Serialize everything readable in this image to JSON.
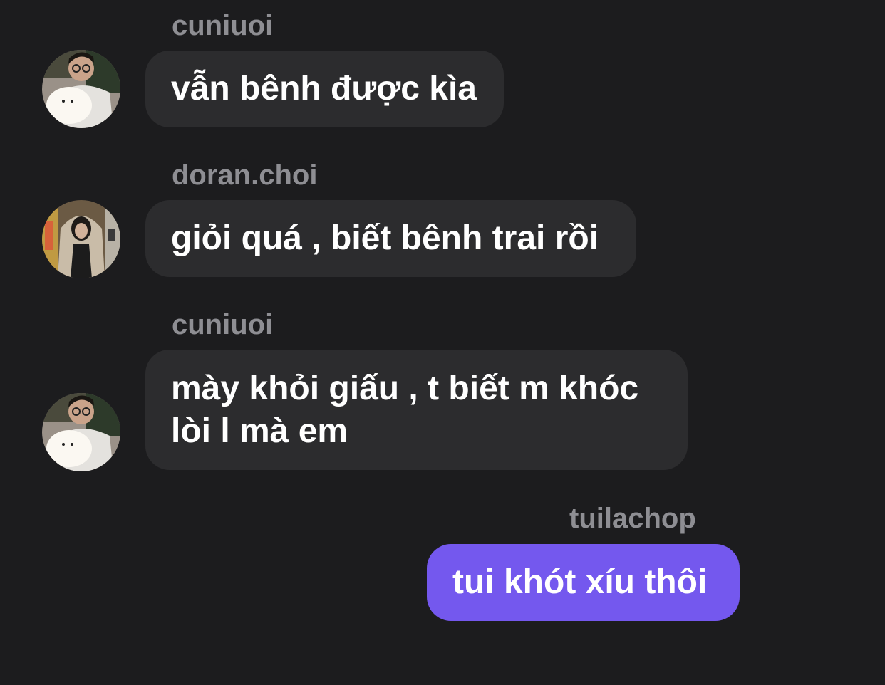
{
  "messages": [
    {
      "sender": "cuniuoi",
      "text": "vẫn bênh được kìa",
      "avatar_icon": "boy-with-white-dog-avatar-icon"
    },
    {
      "sender": "doran.choi",
      "text": "giỏi quá , biết bênh trai rồi",
      "avatar_icon": "person-in-hoodie-avatar-icon"
    },
    {
      "sender": "cuniuoi",
      "text": "mày khỏi giấu , t biết m khóc lòi l mà em",
      "avatar_icon": "boy-with-white-dog-avatar-icon"
    },
    {
      "sender": "tuilachop",
      "text": "tui khót xíu thôi"
    }
  ],
  "colors": {
    "background": "#1c1c1e",
    "incoming_bubble": "#2c2c2e",
    "outgoing_bubble": "#7458ee",
    "sender_name": "#8e8e93",
    "message_text": "#ffffff"
  }
}
